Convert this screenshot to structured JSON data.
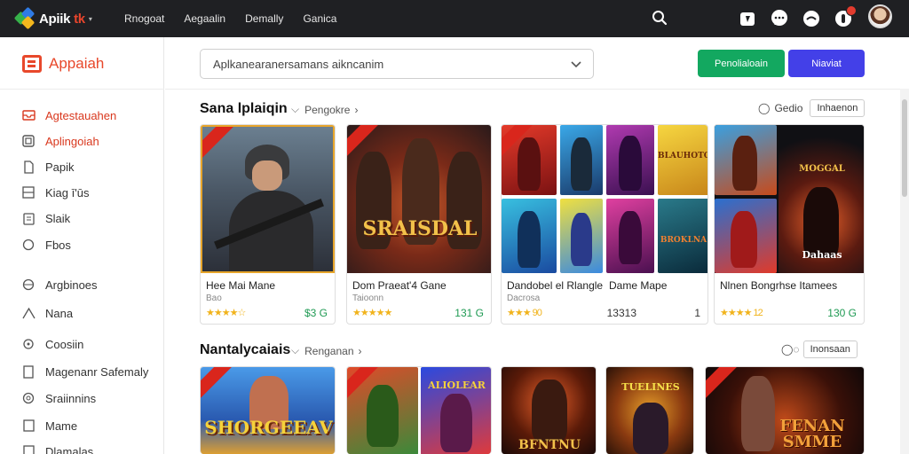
{
  "topbar": {
    "brand_a": "Apiik",
    "brand_b": "tk",
    "nav": [
      "Rnogoat",
      "Aegaalin",
      "Demally",
      "Ganica"
    ]
  },
  "sidebar": {
    "brand": "Appaiah",
    "items": [
      {
        "label": "Agtestauahen",
        "icon": "inbox-icon",
        "active": true
      },
      {
        "label": "Aplingoiah",
        "icon": "app-icon",
        "active": true
      },
      {
        "label": "Papik",
        "icon": "document-icon",
        "active": false
      },
      {
        "label": "Kiag ī'ūs",
        "icon": "layers-icon",
        "active": false
      },
      {
        "label": "Slaik",
        "icon": "clipboard-icon",
        "active": false
      },
      {
        "label": "Fbos",
        "icon": "chat-icon",
        "active": false
      },
      {
        "label": "Argbinoes",
        "icon": "globe-icon",
        "active": false
      },
      {
        "label": "Nana",
        "icon": "triangle-icon",
        "active": false
      },
      {
        "label": "Coosiin",
        "icon": "circle-icon",
        "active": false
      },
      {
        "label": "Magenanr Safemaly",
        "icon": "door-icon",
        "active": false
      },
      {
        "label": "Sraiinnins",
        "icon": "settings-icon",
        "active": false
      },
      {
        "label": "Mame",
        "icon": "window-icon",
        "active": false
      },
      {
        "label": "Dlamalas",
        "icon": "box-icon",
        "active": false
      }
    ]
  },
  "header": {
    "search_value": "Aplkanearanersamans aikncanim",
    "btn_primary": "Penolialoain",
    "btn_secondary": "Niaviat"
  },
  "section1": {
    "title": "Sana lplaiqin",
    "sub": "Pengokre",
    "right_label": "Gedio",
    "right_pill": "Inhaenon",
    "cards": [
      {
        "title": "Hee Mai Mane",
        "sub": "Bao",
        "stars": "★★★★☆",
        "price": "$3 G"
      },
      {
        "title": "Dom Praeat'4 Gane",
        "sub": "Taioonn",
        "stars": "★★★★★",
        "price": "131 G"
      },
      {
        "title": "Dandobel el Rlangle",
        "sub": "Dacrosa",
        "stars": "★★★ 90",
        "price": "13313"
      },
      {
        "title": "Dame Mape",
        "sub": "",
        "stars": "",
        "price": "1"
      },
      {
        "title": "Nlnen Bongrhse Itamees",
        "sub": "",
        "stars": "★★★★ 12",
        "price": "130 G"
      }
    ],
    "tile_texts": [
      "SRAISDAL",
      "BLAUHOTOA",
      "BROKLNA",
      "Dahaas",
      "MOGGAL"
    ]
  },
  "section2": {
    "title": "Nantalycaiais",
    "sub": "Renganan",
    "right_pill": "Inonsaan",
    "tile_texts": [
      "SHORGEEAV",
      "ALIOLEAR",
      "BFNTNU",
      "TUELINES",
      "FENAN SMME"
    ]
  }
}
